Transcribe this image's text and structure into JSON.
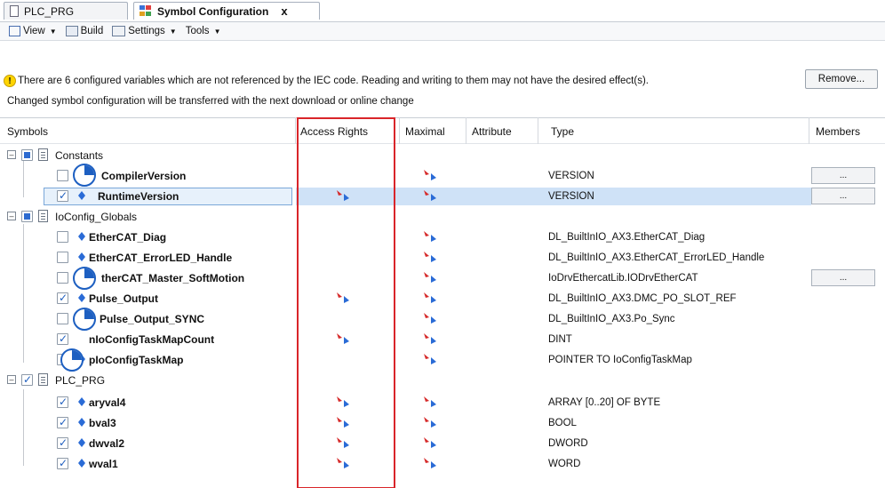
{
  "tabs": [
    {
      "label": "PLC_PRG",
      "active": false
    },
    {
      "label": "Symbol Configuration",
      "active": true,
      "close": "x"
    }
  ],
  "toolbar": {
    "view": "View",
    "build": "Build",
    "settings": "Settings",
    "tools": "Tools"
  },
  "warning": {
    "text": "There are 6 configured variables which are not referenced by the IEC code. Reading and writing to them may not have the desired effect(s).",
    "remove_label": "Remove...",
    "info": "Changed symbol configuration will be transferred with the next download or online change"
  },
  "columns": {
    "symbols": "Symbols",
    "access": "Access Rights",
    "maximal": "Maximal",
    "attribute": "Attribute",
    "type": "Type",
    "members": "Members"
  },
  "rows": [
    {
      "name": "Constants",
      "type": ""
    },
    {
      "name": "CompilerVersion",
      "type": "VERSION",
      "members": "..."
    },
    {
      "name": "RuntimeVersion",
      "type": "VERSION",
      "members": "..."
    },
    {
      "name": "IoConfig_Globals",
      "type": ""
    },
    {
      "name": "EtherCAT_Diag",
      "type": "DL_BuiltInIO_AX3.EtherCAT_Diag"
    },
    {
      "name": "EtherCAT_ErrorLED_Handle",
      "type": "DL_BuiltInIO_AX3.EtherCAT_ErrorLED_Handle"
    },
    {
      "name": "therCAT_Master_SoftMotion",
      "type": "IoDrvEthercatLib.IODrvEtherCAT",
      "members": "..."
    },
    {
      "name": "Pulse_Output",
      "type": "DL_BuiltInIO_AX3.DMC_PO_SLOT_REF"
    },
    {
      "name": "Pulse_Output_SYNC",
      "type": "DL_BuiltInIO_AX3.Po_Sync"
    },
    {
      "name": "nIoConfigTaskMapCount",
      "type": "DINT"
    },
    {
      "name": "pIoConfigTaskMap",
      "type": "POINTER TO IoConfigTaskMap"
    },
    {
      "name": "PLC_PRG",
      "type": ""
    },
    {
      "name": "aryval4",
      "type": "ARRAY [0..20] OF BYTE"
    },
    {
      "name": "bval3",
      "type": "BOOL"
    },
    {
      "name": "dwval2",
      "type": "DWORD"
    },
    {
      "name": "wval1",
      "type": "WORD"
    }
  ],
  "colors": {
    "highlight_box": "#d9252a",
    "selection": "#cfe2f7",
    "checkbox_check": "#1f5fbf"
  }
}
